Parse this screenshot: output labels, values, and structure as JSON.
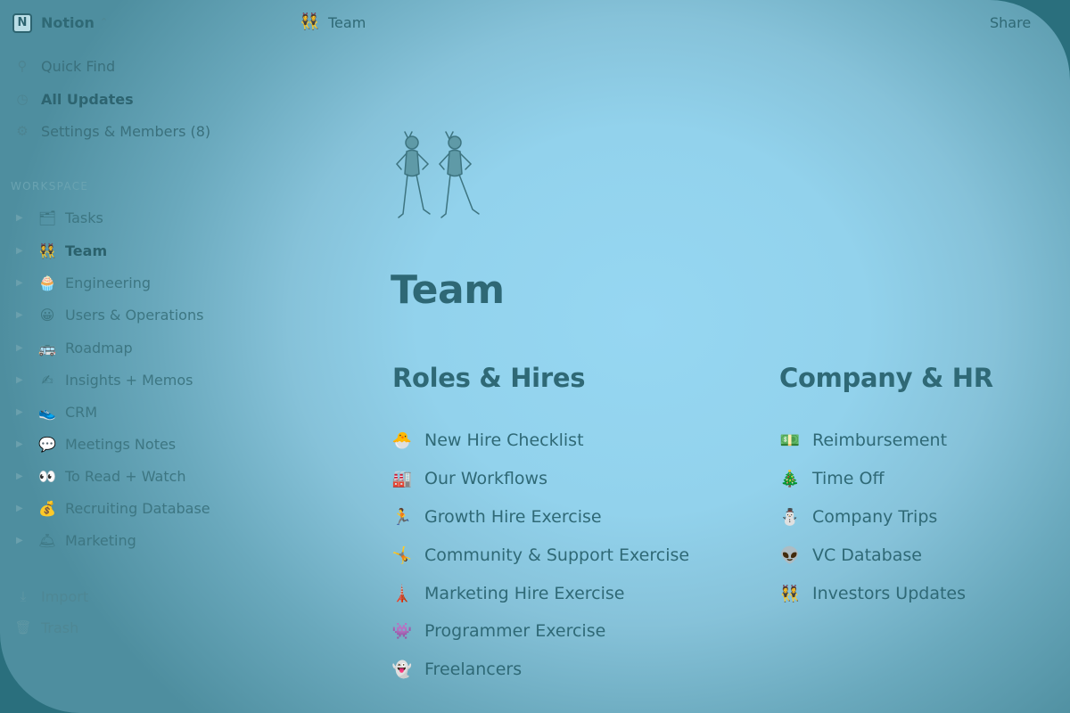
{
  "topbar": {
    "workspace_name": "Notion",
    "logo_letter": "N",
    "chevron": "⌃",
    "breadcrumb": "Team",
    "breadcrumb_icon": "👯",
    "share_label": "Share"
  },
  "sidebar": {
    "top_items": [
      {
        "label": "Quick Find",
        "icon": "search-icon",
        "glyph": "⚲"
      },
      {
        "label": "All Updates",
        "icon": "clock-icon",
        "glyph": "◷"
      },
      {
        "label": "Settings & Members (8)",
        "icon": "gear-icon",
        "glyph": "⚙"
      }
    ],
    "workspace_heading": "WORKSPACE",
    "workspace_items": [
      {
        "label": "Tasks",
        "icon": "tasks-icon",
        "glyph": "🗂"
      },
      {
        "label": "Team",
        "icon": "team-icon",
        "glyph": "👯"
      },
      {
        "label": "Engineering",
        "icon": "engineering-icon",
        "glyph": "🧁"
      },
      {
        "label": "Users & Operations",
        "icon": "users-icon",
        "glyph": "😀"
      },
      {
        "label": "Roadmap",
        "icon": "roadmap-icon",
        "glyph": "🚌"
      },
      {
        "label": "Insights + Memos",
        "icon": "insights-icon",
        "glyph": "✍"
      },
      {
        "label": "CRM",
        "icon": "crm-icon",
        "glyph": "👟"
      },
      {
        "label": "Meetings Notes",
        "icon": "meeting-icon",
        "glyph": "💬"
      },
      {
        "label": "To Read + Watch",
        "icon": "eyes-icon",
        "glyph": "👀"
      },
      {
        "label": "Recruiting Database",
        "icon": "recruiting-icon",
        "glyph": "💰"
      },
      {
        "label": "Marketing",
        "icon": "marketing-icon",
        "glyph": "🛎"
      }
    ],
    "bottom_items": [
      {
        "label": "Import",
        "icon": "import-icon",
        "glyph": "⤓"
      },
      {
        "label": "Trash",
        "icon": "trash-icon",
        "glyph": "🗑"
      }
    ]
  },
  "page": {
    "title": "Team",
    "columns": [
      {
        "heading": "Roles & Hires",
        "links": [
          {
            "label": "New Hire Checklist",
            "icon": "checklist-icon",
            "glyph": "🐣"
          },
          {
            "label": "Our Workflows",
            "icon": "workflows-icon",
            "glyph": "🏭"
          },
          {
            "label": "Growth Hire Exercise",
            "icon": "runner-icon",
            "glyph": "🏃"
          },
          {
            "label": "Community & Support Exercise",
            "icon": "support-icon",
            "glyph": "🤸"
          },
          {
            "label": "Marketing Hire Exercise",
            "icon": "marketing-hire-icon",
            "glyph": "🗼"
          },
          {
            "label": "Programmer Exercise",
            "icon": "programmer-icon",
            "glyph": "👾"
          },
          {
            "label": "Freelancers",
            "icon": "freelancers-icon",
            "glyph": "👻"
          }
        ]
      },
      {
        "heading": "Company & HR",
        "links": [
          {
            "label": "Reimbursement",
            "icon": "money-icon",
            "glyph": "💵"
          },
          {
            "label": "Time Off",
            "icon": "tree-icon",
            "glyph": "🎄"
          },
          {
            "label": "Company Trips",
            "icon": "snowman-icon",
            "glyph": "⛄"
          },
          {
            "label": "VC Database",
            "icon": "alien-icon",
            "glyph": "👽"
          },
          {
            "label": "Investors Updates",
            "icon": "investors-icon",
            "glyph": "👯"
          }
        ]
      }
    ]
  }
}
